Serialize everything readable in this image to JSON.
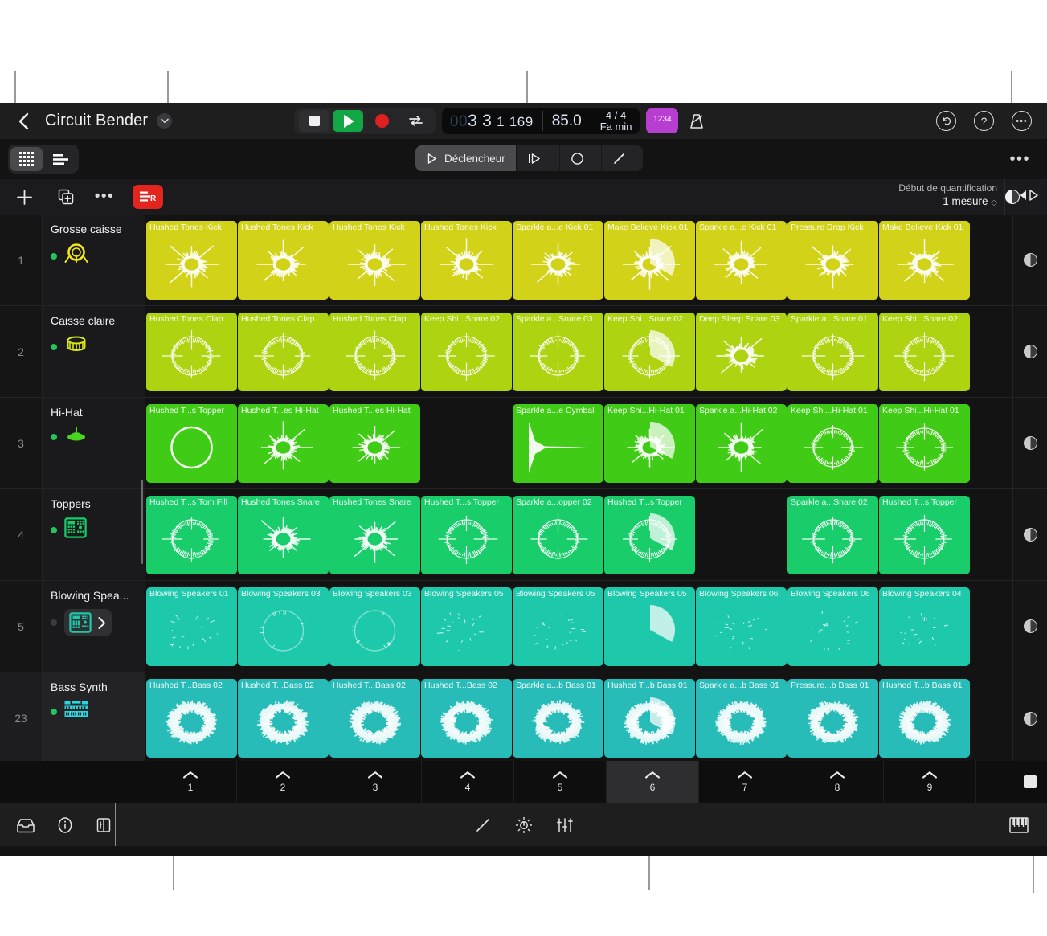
{
  "header": {
    "back_icon": "chevron-left-icon",
    "project_title": "Circuit Bender",
    "project_menu_icon": "chevron-down-icon",
    "transport": {
      "stop_label": "stop-icon",
      "play_label": "play-icon",
      "record_label": "record-icon",
      "cycle_label": "cycle-icon"
    },
    "lcd": {
      "position_dim": "00",
      "position_bar": "3",
      "position_beat": "3",
      "position_div": "1",
      "position_ticks": "169",
      "tempo": "85.0",
      "time_signature": "4 / 4",
      "key": "Fa min"
    },
    "count_in_label": "1234",
    "metronome_icon": "metronome-icon",
    "undo_icon": "undo-icon",
    "help_icon": "help-icon",
    "more_icon": "more-icon"
  },
  "view_switch": {
    "grid_view_label": "grid-view-icon",
    "list_view_label": "list-view-icon"
  },
  "mode_pills": [
    {
      "label": "Déclencheur",
      "icon": "play-outline-icon",
      "active": true
    },
    {
      "label": "",
      "icon": "play-from-start-icon",
      "active": false
    },
    {
      "label": "",
      "icon": "circle-icon",
      "active": false
    },
    {
      "label": "",
      "icon": "pencil-line-icon",
      "active": false
    }
  ],
  "bar2_more_icon": "more-horizontal-icon",
  "track_controls": {
    "add_icon": "plus-icon",
    "duplicate_icon": "duplicate-icon",
    "more_icon": "more-horizontal-icon",
    "record_enable_icon": "record-arm-icon",
    "quantize_title": "Début de quantification",
    "quantize_value": "1 mesure",
    "quantize_value_icon": "stepper-icon",
    "half_circle_icon": "half-circle-icon",
    "playhead_icon": "playhead-icon"
  },
  "colors": {
    "row1": "#d2d219",
    "row2": "#aed311",
    "row3": "#3fcb16",
    "row4": "#18cd6a",
    "row5": "#1ec9ab",
    "row6": "#28bcb8"
  },
  "tracks": [
    {
      "number": "1",
      "name": "Grosse caisse",
      "led": "on",
      "icon": "kick-drum-icon",
      "icon_color": "#f2e717",
      "color": "#d2d219",
      "selected": false,
      "has_chevron": false,
      "cells": [
        {
          "label": "Hushed Tones Kick",
          "art": "burst"
        },
        {
          "label": "Hushed Tones Kick",
          "art": "burst"
        },
        {
          "label": "Hushed Tones Kick",
          "art": "burst"
        },
        {
          "label": "Hushed Tones Kick",
          "art": "burst"
        },
        {
          "label": "Sparkle a...e Kick 01",
          "art": "burst"
        },
        {
          "label": "Make Believe Kick 01",
          "art": "burst-pie"
        },
        {
          "label": "Sparkle a...e Kick 01",
          "art": "burst"
        },
        {
          "label": "Pressure Drop Kick",
          "art": "burst"
        },
        {
          "label": "Make Believe Kick 01",
          "art": "burst"
        }
      ]
    },
    {
      "number": "2",
      "name": "Caisse claire",
      "led": "on",
      "icon": "snare-drum-icon",
      "icon_color": "#d9ea12",
      "color": "#aed311",
      "selected": false,
      "has_chevron": false,
      "cells": [
        {
          "label": "Hushed Tones Clap",
          "art": "ring"
        },
        {
          "label": "Hushed Tones Clap",
          "art": "ring"
        },
        {
          "label": "Hushed Tones Clap",
          "art": "ring"
        },
        {
          "label": "Keep Shi...Snare 02",
          "art": "ring"
        },
        {
          "label": "Sparkle a...Snare 03",
          "art": "ring"
        },
        {
          "label": "Keep Shi...Snare 02",
          "art": "ring-pie"
        },
        {
          "label": "Deep Sleep Snare 03",
          "art": "burst"
        },
        {
          "label": "Sparkle a...Snare 01",
          "art": "ring"
        },
        {
          "label": "Keep Shi...Snare 02",
          "art": "ring"
        }
      ]
    },
    {
      "number": "3",
      "name": "Hi-Hat",
      "led": "on",
      "icon": "hihat-icon",
      "icon_color": "#49d61e",
      "color": "#3fcb16",
      "selected": false,
      "has_chevron": false,
      "cells": [
        {
          "label": "Hushed T...s Topper",
          "art": "circle"
        },
        {
          "label": "Hushed T...es Hi-Hat",
          "art": "burst"
        },
        {
          "label": "Hushed T...es Hi-Hat",
          "art": "burst"
        },
        {
          "label": "",
          "art": "empty"
        },
        {
          "label": "Sparkle a...e Cymbal",
          "art": "decay"
        },
        {
          "label": "Keep Shi...Hi-Hat 01",
          "art": "burst-pie"
        },
        {
          "label": "Sparkle a...Hi-Hat 02",
          "art": "burst"
        },
        {
          "label": "Keep Shi...Hi-Hat 01",
          "art": "ring"
        },
        {
          "label": "Keep Shi...Hi-Hat 01",
          "art": "ring"
        }
      ]
    },
    {
      "number": "4",
      "name": "Toppers",
      "led": "on",
      "icon": "sampler-icon",
      "icon_color": "#18cd6a",
      "color": "#18cd6a",
      "selected": false,
      "has_chevron": false,
      "cells": [
        {
          "label": "Hushed T...s Tom Fill",
          "art": "ring"
        },
        {
          "label": "Hushed Tones Snare",
          "art": "burst"
        },
        {
          "label": "Hushed Tones Snare",
          "art": "burst"
        },
        {
          "label": "Hushed T...s Topper",
          "art": "ring"
        },
        {
          "label": "Sparkle a...opper 02",
          "art": "ring"
        },
        {
          "label": "Hushed T...s Topper",
          "art": "ring-pie"
        },
        {
          "label": "",
          "art": "empty"
        },
        {
          "label": "Sparkle a...Snare 02",
          "art": "ring"
        },
        {
          "label": "Hushed T...s Topper",
          "art": "ring"
        }
      ]
    },
    {
      "number": "5",
      "name": "Blowing Spea...",
      "led": "off",
      "icon": "sampler-icon",
      "icon_color": "#1ec9ab",
      "color": "#1ec9ab",
      "selected": false,
      "has_chevron": true,
      "cells": [
        {
          "label": "Blowing Speakers 01",
          "art": "sparse"
        },
        {
          "label": "Blowing Speakers 03",
          "art": "ring-faint"
        },
        {
          "label": "Blowing Speakers 03",
          "art": "ring-faint"
        },
        {
          "label": "Blowing Speakers 05",
          "art": "sparse"
        },
        {
          "label": "Blowing Speakers 05",
          "art": "sparse"
        },
        {
          "label": "Blowing Speakers 05",
          "art": "pie-only"
        },
        {
          "label": "Blowing Speakers 06",
          "art": "sparse"
        },
        {
          "label": "Blowing Speakers 06",
          "art": "sparse"
        },
        {
          "label": "Blowing Speakers 04",
          "art": "sparse"
        }
      ]
    },
    {
      "number": "23",
      "name": "Bass Synth",
      "led": "on",
      "icon": "synth-keyboard-icon",
      "icon_color": "#2ad6dd",
      "color": "#28bcb8",
      "selected": true,
      "has_chevron": false,
      "cells": [
        {
          "label": "Hushed T...Bass 02",
          "art": "thick-ring"
        },
        {
          "label": "Hushed T...Bass 02",
          "art": "thick-ring"
        },
        {
          "label": "Hushed T...Bass 02",
          "art": "thick-ring"
        },
        {
          "label": "Hushed T...Bass 02",
          "art": "thick-ring"
        },
        {
          "label": "Sparkle a...b Bass 01",
          "art": "thick-ring"
        },
        {
          "label": "Hushed T...b Bass 01",
          "art": "thick-ring-pie"
        },
        {
          "label": "Sparkle a...b Bass 01",
          "art": "thick-ring"
        },
        {
          "label": "Pressure...b Bass 01",
          "art": "thick-ring"
        },
        {
          "label": "Hushed T...b Bass 01",
          "art": "thick-ring"
        }
      ]
    }
  ],
  "scenes": [
    {
      "number": "1",
      "active": false
    },
    {
      "number": "2",
      "active": false
    },
    {
      "number": "3",
      "active": false
    },
    {
      "number": "4",
      "active": false
    },
    {
      "number": "5",
      "active": false
    },
    {
      "number": "6",
      "active": true
    },
    {
      "number": "7",
      "active": false
    },
    {
      "number": "8",
      "active": false
    },
    {
      "number": "9",
      "active": false
    }
  ],
  "scene_stop_icon": "stop-all-icon",
  "footer": {
    "left_icons": [
      "loops-browser-icon",
      "info-icon",
      "panel-icon"
    ],
    "center_icons": [
      "pencil-icon",
      "automation-icon",
      "mixer-icon"
    ],
    "right_icon": "keyboard-icon"
  }
}
